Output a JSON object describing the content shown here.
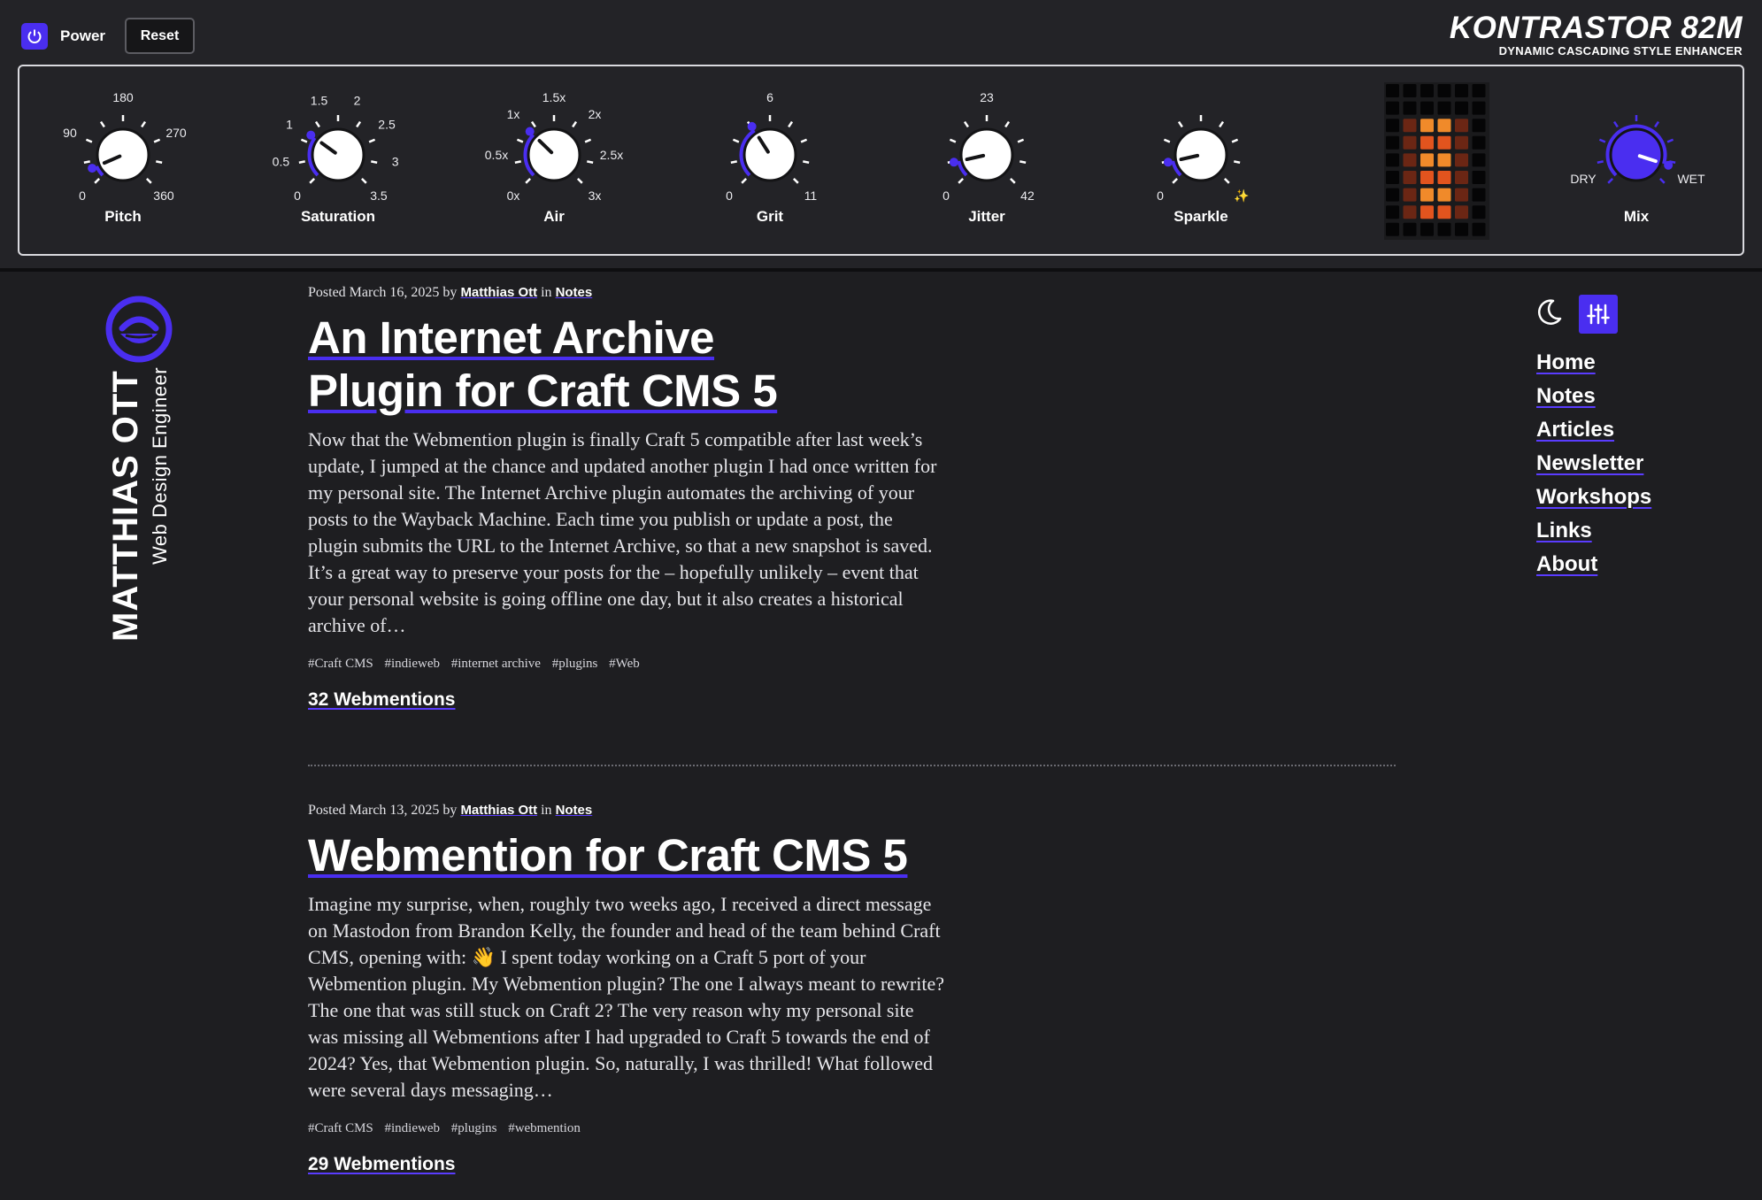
{
  "panel": {
    "power_label": "Power",
    "reset_label": "Reset",
    "brand_title": "KONTRASTOR 82M",
    "brand_subtitle": "DYNAMIC CASCADING STYLE ENHANCER",
    "accent": "#4a2ef0",
    "knobs": [
      {
        "label": "Pitch",
        "ticks": [
          "0",
          "90",
          "180",
          "270",
          "360"
        ],
        "value_fraction": 0.08
      },
      {
        "label": "Saturation",
        "ticks": [
          "0",
          "0.5",
          "1",
          "1.5",
          "2",
          "2.5",
          "3",
          "3.5"
        ],
        "value_fraction": 0.3
      },
      {
        "label": "Air",
        "ticks": [
          "0x",
          "0.5x",
          "1x",
          "1.5x",
          "2x",
          "2.5x",
          "3x"
        ],
        "value_fraction": 0.33
      },
      {
        "label": "Grit",
        "ticks": [
          "0",
          "6",
          "11"
        ],
        "value_fraction": 0.38
      },
      {
        "label": "Jitter",
        "ticks": [
          "0",
          "23",
          "42"
        ],
        "value_fraction": 0.12
      },
      {
        "label": "Sparkle",
        "ticks": [
          "0",
          "✨"
        ],
        "value_fraction": 0.12
      },
      {
        "label": "Mix",
        "ticks": [
          "DRY",
          "WET"
        ],
        "value_fraction": 0.9
      }
    ]
  },
  "sidebar": {
    "name": "MATTHIAS OTT",
    "role": "Web Design Engineer"
  },
  "articles": [
    {
      "posted": "Posted March 16, 2025 by",
      "author": "Matthias Ott",
      "in": "in",
      "category": "Notes",
      "title_line1": "An Internet Archive",
      "title_line2": "Plugin for Craft CMS 5",
      "body": "Now that the Webmention plugin is finally Craft 5 compatible after last week’s update, I jumped at the chance and updated another plugin I had once written for my personal site. The Internet Archive plugin automates the archiving of your posts to the Wayback Machine. Each time you publish or update a post, the plugin submits the URL to the Internet Archive, so that a new snapshot is saved. It’s a great way to preserve your posts for the – hopefully unlikely – event that your personal website is going offline one day, but it also creates a historical archive of…",
      "tags": [
        "#Craft CMS",
        "#indieweb",
        "#internet archive",
        "#plugins",
        "#Web"
      ],
      "webmentions": "32 Webmentions"
    },
    {
      "posted": "Posted March 13, 2025 by",
      "author": "Matthias Ott",
      "in": "in",
      "category": "Notes",
      "title": "Webmention for Craft CMS 5",
      "body": "Imagine my surprise, when, roughly two weeks ago, I received a direct message on Mastodon from Brandon Kelly, the founder and head of the team behind Craft CMS, opening with: 👋 I spent today working on a Craft 5 port of your Webmention plugin. My Webmention plugin? The one I always meant to rewrite? The one that was still stuck on Craft 2? The very reason why my personal site was missing all Webmentions after I had upgraded to Craft 5 towards the end of 2024? Yes, that Webmention plugin. So, naturally, I was thrilled! What followed were several days messaging…",
      "tags": [
        "#Craft CMS",
        "#indieweb",
        "#plugins",
        "#webmention"
      ],
      "webmentions": "29 Webmentions"
    }
  ],
  "nav": {
    "items": [
      "Home",
      "Notes",
      "Articles",
      "Newsletter",
      "Workshops",
      "Links",
      "About"
    ],
    "theme_toggle_icon": "moon-icon",
    "settings_icon": "sliders-icon"
  }
}
